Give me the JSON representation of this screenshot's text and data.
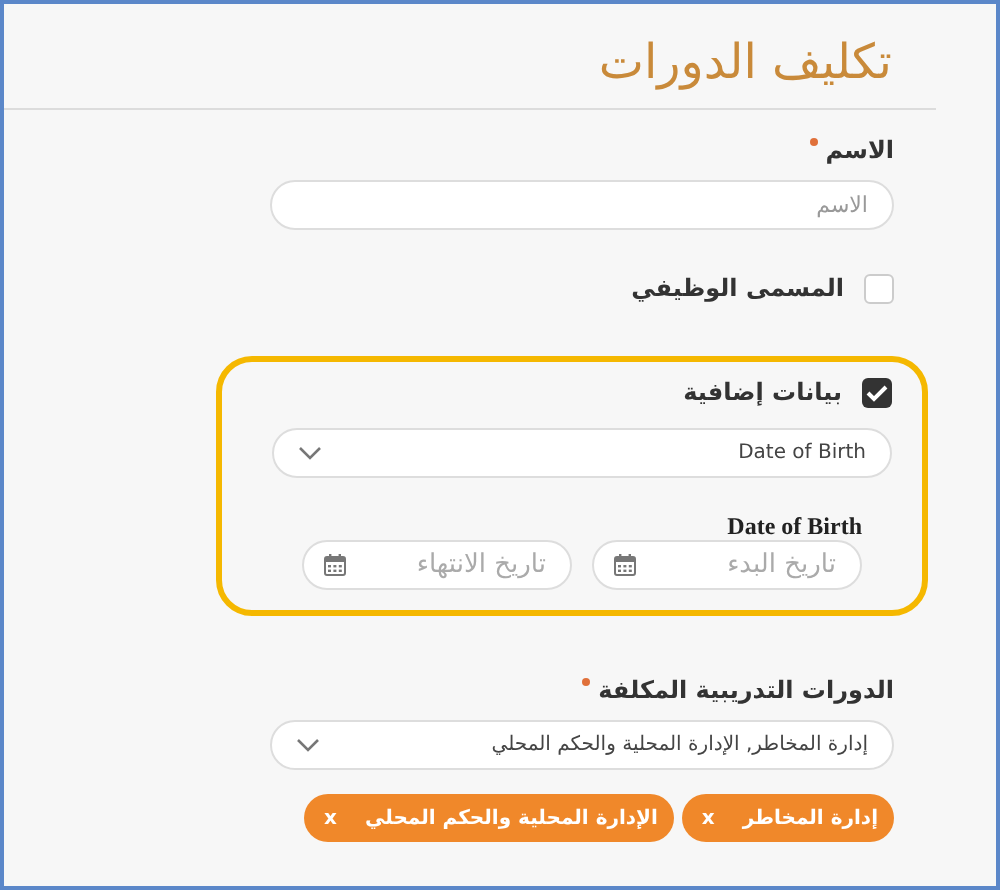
{
  "title": "تكليف الدورات",
  "name_field": {
    "label": "الاسم",
    "required": true,
    "placeholder": "الاسم"
  },
  "job_title": {
    "label": "المسمى الوظيفي",
    "checked": false
  },
  "extra_data": {
    "label": "بيانات إضافية",
    "checked": true,
    "highlighted": true,
    "select": {
      "value": "Date of Birth"
    },
    "date_label": "Date of Birth",
    "start_date": {
      "placeholder": "تاريخ البدء"
    },
    "end_date": {
      "placeholder": "تاريخ الانتهاء"
    }
  },
  "courses": {
    "label": "الدورات التدريبية المكلفة",
    "required": true,
    "value": "إدارة المخاطر, الإدارة المحلية والحكم المحلي",
    "chips": [
      {
        "label": "إدارة المخاطر",
        "remove": "x"
      },
      {
        "label": "الإدارة المحلية والحكم المحلي",
        "remove": "x"
      }
    ]
  }
}
